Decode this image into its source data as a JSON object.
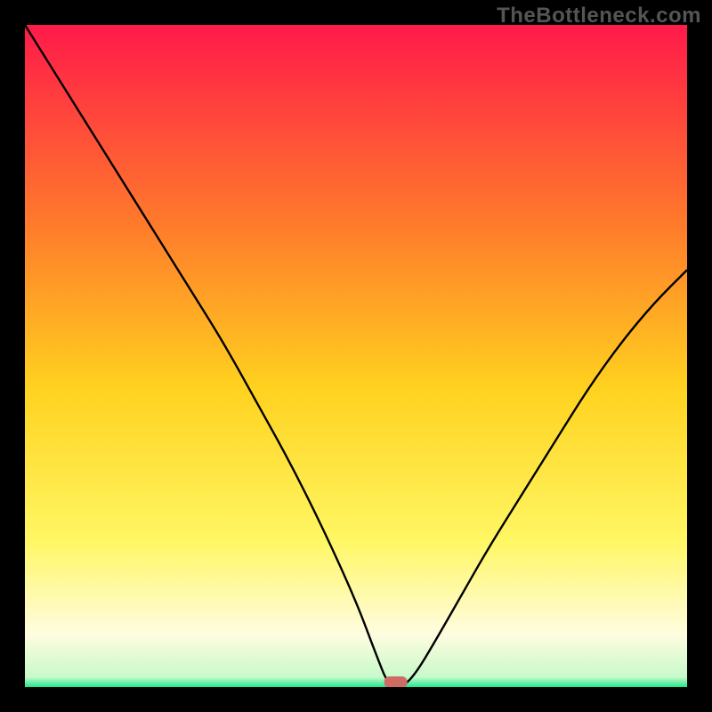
{
  "watermark": "TheBottleneck.com",
  "colors": {
    "top": "#ff1a4a",
    "mid_upper": "#ff7a2b",
    "mid": "#ffd21f",
    "mid_lower": "#fff764",
    "cream": "#fffce0",
    "green": "#1de88a",
    "curve": "#000000",
    "marker": "#d06a65",
    "frame": "#000000"
  },
  "chart_data": {
    "type": "line",
    "title": "",
    "xlabel": "",
    "ylabel": "",
    "xlim": [
      0,
      100
    ],
    "ylim": [
      0,
      100
    ],
    "series": [
      {
        "name": "bottleneck-curve",
        "x": [
          0,
          5,
          10,
          15,
          20,
          25,
          30,
          35,
          40,
          45,
          50,
          53,
          55,
          57,
          59,
          62,
          66,
          70,
          75,
          80,
          85,
          90,
          95,
          100
        ],
        "values": [
          100,
          92,
          84,
          76,
          68,
          60,
          52,
          43,
          34,
          24,
          13,
          5,
          0,
          0,
          2,
          7,
          14,
          21,
          29,
          37,
          45,
          52,
          58,
          63
        ]
      }
    ],
    "marker": {
      "x": 56,
      "y": 0,
      "name": "optimal-point"
    },
    "gradient_stops": [
      {
        "pos": 0.0,
        "color": "#ff1a4a"
      },
      {
        "pos": 0.3,
        "color": "#ff7a2b"
      },
      {
        "pos": 0.55,
        "color": "#ffd21f"
      },
      {
        "pos": 0.78,
        "color": "#fff764"
      },
      {
        "pos": 0.92,
        "color": "#fffce0"
      },
      {
        "pos": 0.985,
        "color": "#c8facb"
      },
      {
        "pos": 1.0,
        "color": "#1de88a"
      }
    ]
  }
}
